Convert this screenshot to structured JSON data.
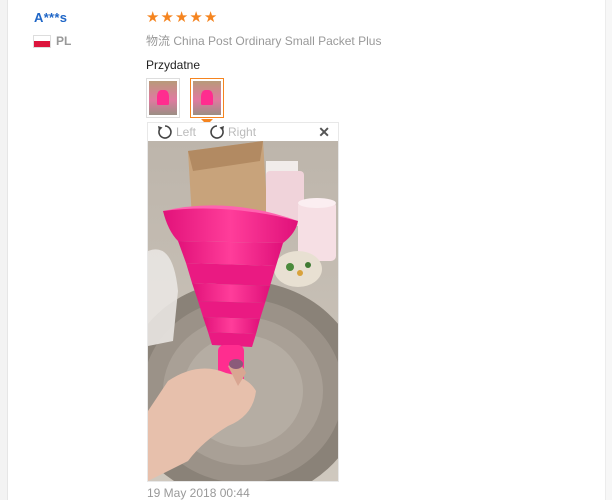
{
  "user": {
    "name": "A***s",
    "country_code": "PL"
  },
  "review": {
    "stars": 5,
    "shipping_label": "物流",
    "shipping_method": "China Post Ordinary Small Packet Plus",
    "feedback": "Przydatne",
    "date": "19 May 2018 00:44"
  },
  "viewer": {
    "rotate_left_label": "Left",
    "rotate_right_label": "Right"
  },
  "colors": {
    "star": "#f5841f",
    "username": "#1f66c7",
    "active_thumb_border": "#f5841f",
    "product": "#ff2d8f"
  }
}
